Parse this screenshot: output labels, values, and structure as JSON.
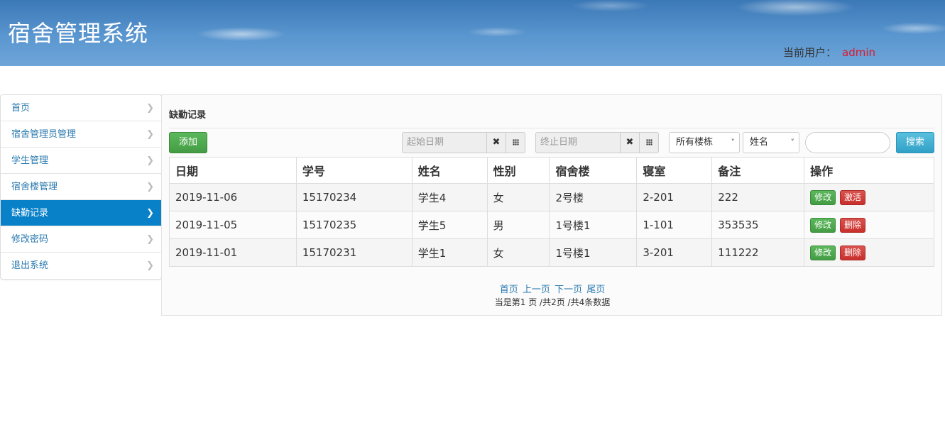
{
  "header": {
    "title": "宿舍管理系统",
    "user_label": "当前用户：",
    "user_name": "admin"
  },
  "sidebar": {
    "items": [
      {
        "label": "首页",
        "active": false
      },
      {
        "label": "宿舍管理员管理",
        "active": false
      },
      {
        "label": "学生管理",
        "active": false
      },
      {
        "label": "宿舍楼管理",
        "active": false
      },
      {
        "label": "缺勤记录",
        "active": true
      },
      {
        "label": "修改密码",
        "active": false
      },
      {
        "label": "退出系统",
        "active": false
      }
    ],
    "chevron_icon": "chevron-right-icon"
  },
  "main": {
    "title": "缺勤记录",
    "add_label": "添加",
    "start_date_placeholder": "起始日期",
    "end_date_placeholder": "终止日期",
    "building_select": "所有楼栋",
    "field_select": "姓名",
    "search_value": "",
    "search_label": "搜索"
  },
  "table": {
    "headers": [
      "日期",
      "学号",
      "姓名",
      "性别",
      "宿舍楼",
      "寝室",
      "备注",
      "操作"
    ],
    "rows": [
      {
        "date": "2019-11-06",
        "sid": "15170234",
        "name": "学生4",
        "gender": "女",
        "building": "2号楼",
        "room": "2-201",
        "note": "222",
        "edit": "修改",
        "action": "激活"
      },
      {
        "date": "2019-11-05",
        "sid": "15170235",
        "name": "学生5",
        "gender": "男",
        "building": "1号楼1",
        "room": "1-101",
        "note": "353535",
        "edit": "修改",
        "action": "删除"
      },
      {
        "date": "2019-11-01",
        "sid": "15170231",
        "name": "学生1",
        "gender": "女",
        "building": "1号楼1",
        "room": "3-201",
        "note": "111222",
        "edit": "修改",
        "action": "删除"
      }
    ]
  },
  "pagination": {
    "first": "首页",
    "prev": "上一页",
    "next": "下一页",
    "last": "尾页",
    "info": "当是第1 页 /共2页  /共4条数据"
  },
  "colors": {
    "accent": "#0981c9",
    "link": "#2a7ab0",
    "username": "#e0162b",
    "success": "#5cb85c",
    "danger": "#d9534f",
    "info": "#5bc0de"
  }
}
